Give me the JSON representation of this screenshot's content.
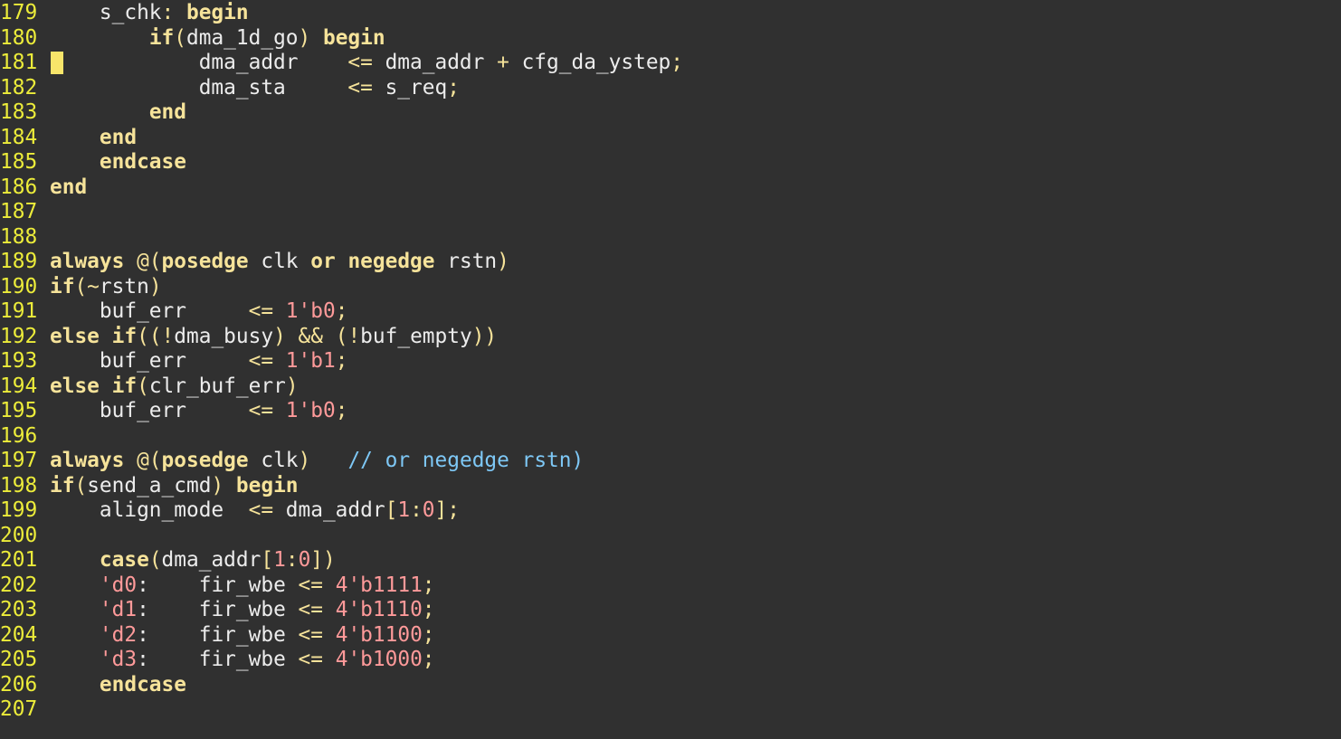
{
  "editor": {
    "lines": [
      {
        "num": "179",
        "tokens": [
          {
            "t": "    s_chk",
            "c": "pl"
          },
          {
            "t": ": ",
            "c": "pu"
          },
          {
            "t": "begin",
            "c": "kw"
          }
        ]
      },
      {
        "num": "180",
        "tokens": [
          {
            "t": "        ",
            "c": "pl"
          },
          {
            "t": "if",
            "c": "kw"
          },
          {
            "t": "(",
            "c": "pu"
          },
          {
            "t": "dma_1d_go",
            "c": "pl"
          },
          {
            "t": ") ",
            "c": "pu"
          },
          {
            "t": "begin",
            "c": "kw"
          }
        ]
      },
      {
        "num": "181",
        "tokens": [
          {
            "t": "            dma_addr    ",
            "c": "pl"
          },
          {
            "t": "<=",
            "c": "op"
          },
          {
            "t": " dma_addr ",
            "c": "pl"
          },
          {
            "t": "+",
            "c": "op"
          },
          {
            "t": " cfg_da_ystep",
            "c": "pl"
          },
          {
            "t": ";",
            "c": "pu"
          }
        ]
      },
      {
        "num": "182",
        "tokens": [
          {
            "t": "            dma_sta     ",
            "c": "pl"
          },
          {
            "t": "<=",
            "c": "op"
          },
          {
            "t": " s_req",
            "c": "pl"
          },
          {
            "t": ";",
            "c": "pu"
          }
        ]
      },
      {
        "num": "183",
        "tokens": [
          {
            "t": "        ",
            "c": "pl"
          },
          {
            "t": "end",
            "c": "kw"
          }
        ]
      },
      {
        "num": "184",
        "tokens": [
          {
            "t": "    ",
            "c": "pl"
          },
          {
            "t": "end",
            "c": "kw"
          }
        ]
      },
      {
        "num": "185",
        "tokens": [
          {
            "t": "    ",
            "c": "pl"
          },
          {
            "t": "endcase",
            "c": "kw"
          }
        ]
      },
      {
        "num": "186",
        "tokens": [
          {
            "t": "end",
            "c": "kw"
          }
        ]
      },
      {
        "num": "187",
        "tokens": []
      },
      {
        "num": "188",
        "tokens": []
      },
      {
        "num": "189",
        "tokens": [
          {
            "t": "always",
            "c": "kw"
          },
          {
            "t": " @(",
            "c": "pu"
          },
          {
            "t": "posedge",
            "c": "kw"
          },
          {
            "t": " clk ",
            "c": "pl"
          },
          {
            "t": "or",
            "c": "kw"
          },
          {
            "t": " ",
            "c": "pl"
          },
          {
            "t": "negedge",
            "c": "kw"
          },
          {
            "t": " rstn",
            "c": "pl"
          },
          {
            "t": ")",
            "c": "pu"
          }
        ]
      },
      {
        "num": "190",
        "tokens": [
          {
            "t": "if",
            "c": "kw"
          },
          {
            "t": "(~",
            "c": "pu"
          },
          {
            "t": "rstn",
            "c": "pl"
          },
          {
            "t": ")",
            "c": "pu"
          }
        ]
      },
      {
        "num": "191",
        "tokens": [
          {
            "t": "    buf_err     ",
            "c": "pl"
          },
          {
            "t": "<=",
            "c": "op"
          },
          {
            "t": " ",
            "c": "pl"
          },
          {
            "t": "1'b0",
            "c": "nm"
          },
          {
            "t": ";",
            "c": "pu"
          }
        ]
      },
      {
        "num": "192",
        "tokens": [
          {
            "t": "else",
            "c": "kw"
          },
          {
            "t": " ",
            "c": "pl"
          },
          {
            "t": "if",
            "c": "kw"
          },
          {
            "t": "((!",
            "c": "pu"
          },
          {
            "t": "dma_busy",
            "c": "pl"
          },
          {
            "t": ") && (!",
            "c": "pu"
          },
          {
            "t": "buf_empty",
            "c": "pl"
          },
          {
            "t": "))",
            "c": "pu"
          }
        ]
      },
      {
        "num": "193",
        "tokens": [
          {
            "t": "    buf_err     ",
            "c": "pl"
          },
          {
            "t": "<=",
            "c": "op"
          },
          {
            "t": " ",
            "c": "pl"
          },
          {
            "t": "1'b1",
            "c": "nm"
          },
          {
            "t": ";",
            "c": "pu"
          }
        ]
      },
      {
        "num": "194",
        "tokens": [
          {
            "t": "else",
            "c": "kw"
          },
          {
            "t": " ",
            "c": "pl"
          },
          {
            "t": "if",
            "c": "kw"
          },
          {
            "t": "(",
            "c": "pu"
          },
          {
            "t": "clr_buf_err",
            "c": "pl"
          },
          {
            "t": ")",
            "c": "pu"
          }
        ]
      },
      {
        "num": "195",
        "tokens": [
          {
            "t": "    buf_err     ",
            "c": "pl"
          },
          {
            "t": "<=",
            "c": "op"
          },
          {
            "t": " ",
            "c": "pl"
          },
          {
            "t": "1'b0",
            "c": "nm"
          },
          {
            "t": ";",
            "c": "pu"
          }
        ]
      },
      {
        "num": "196",
        "tokens": []
      },
      {
        "num": "197",
        "tokens": [
          {
            "t": "always",
            "c": "kw"
          },
          {
            "t": " @(",
            "c": "pu"
          },
          {
            "t": "posedge",
            "c": "kw"
          },
          {
            "t": " clk",
            "c": "pl"
          },
          {
            "t": ")",
            "c": "pu"
          },
          {
            "t": "   ",
            "c": "pl"
          },
          {
            "t": "// or negedge rstn)",
            "c": "cm"
          }
        ]
      },
      {
        "num": "198",
        "tokens": [
          {
            "t": "if",
            "c": "kw"
          },
          {
            "t": "(",
            "c": "pu"
          },
          {
            "t": "send_a_cmd",
            "c": "pl"
          },
          {
            "t": ") ",
            "c": "pu"
          },
          {
            "t": "begin",
            "c": "kw"
          }
        ]
      },
      {
        "num": "199",
        "tokens": [
          {
            "t": "    align_mode  ",
            "c": "pl"
          },
          {
            "t": "<=",
            "c": "op"
          },
          {
            "t": " dma_addr",
            "c": "pl"
          },
          {
            "t": "[",
            "c": "pu"
          },
          {
            "t": "1",
            "c": "nm"
          },
          {
            "t": ":",
            "c": "pu"
          },
          {
            "t": "0",
            "c": "nm"
          },
          {
            "t": "];",
            "c": "pu"
          }
        ]
      },
      {
        "num": "200",
        "tokens": []
      },
      {
        "num": "201",
        "tokens": [
          {
            "t": "    ",
            "c": "pl"
          },
          {
            "t": "case",
            "c": "kw"
          },
          {
            "t": "(",
            "c": "pu"
          },
          {
            "t": "dma_addr",
            "c": "pl"
          },
          {
            "t": "[",
            "c": "pu"
          },
          {
            "t": "1",
            "c": "nm"
          },
          {
            "t": ":",
            "c": "pu"
          },
          {
            "t": "0",
            "c": "nm"
          },
          {
            "t": "])",
            "c": "pu"
          }
        ]
      },
      {
        "num": "202",
        "tokens": [
          {
            "t": "    ",
            "c": "pl"
          },
          {
            "t": "'d0",
            "c": "nm"
          },
          {
            "t": ":    fir_wbe ",
            "c": "pl"
          },
          {
            "t": "<=",
            "c": "op"
          },
          {
            "t": " ",
            "c": "pl"
          },
          {
            "t": "4'b1111",
            "c": "nm"
          },
          {
            "t": ";",
            "c": "pu"
          }
        ]
      },
      {
        "num": "203",
        "tokens": [
          {
            "t": "    ",
            "c": "pl"
          },
          {
            "t": "'d1",
            "c": "nm"
          },
          {
            "t": ":    fir_wbe ",
            "c": "pl"
          },
          {
            "t": "<=",
            "c": "op"
          },
          {
            "t": " ",
            "c": "pl"
          },
          {
            "t": "4'b1110",
            "c": "nm"
          },
          {
            "t": ";",
            "c": "pu"
          }
        ]
      },
      {
        "num": "204",
        "tokens": [
          {
            "t": "    ",
            "c": "pl"
          },
          {
            "t": "'d2",
            "c": "nm"
          },
          {
            "t": ":    fir_wbe ",
            "c": "pl"
          },
          {
            "t": "<=",
            "c": "op"
          },
          {
            "t": " ",
            "c": "pl"
          },
          {
            "t": "4'b1100",
            "c": "nm"
          },
          {
            "t": ";",
            "c": "pu"
          }
        ]
      },
      {
        "num": "205",
        "tokens": [
          {
            "t": "    ",
            "c": "pl"
          },
          {
            "t": "'d3",
            "c": "nm"
          },
          {
            "t": ":    fir_wbe ",
            "c": "pl"
          },
          {
            "t": "<=",
            "c": "op"
          },
          {
            "t": " ",
            "c": "pl"
          },
          {
            "t": "4'b1000",
            "c": "nm"
          },
          {
            "t": ";",
            "c": "pu"
          }
        ]
      },
      {
        "num": "206",
        "tokens": [
          {
            "t": "    ",
            "c": "pl"
          },
          {
            "t": "endcase",
            "c": "kw"
          }
        ]
      },
      {
        "num": "207",
        "tokens": []
      }
    ]
  }
}
